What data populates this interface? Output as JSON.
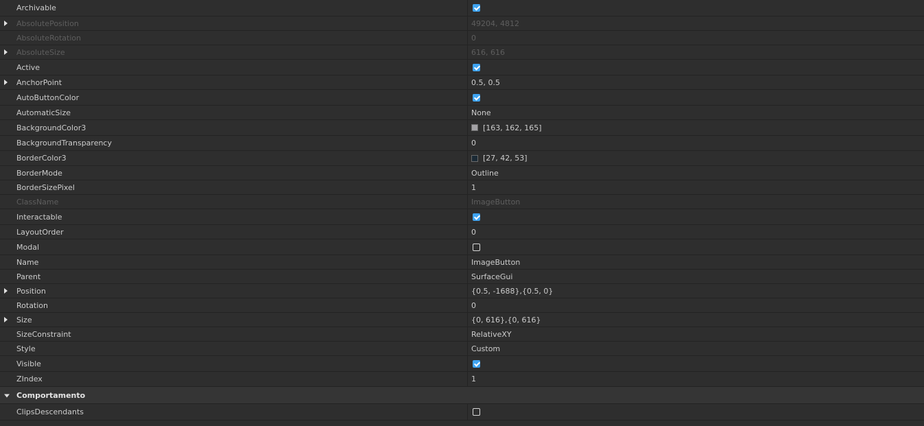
{
  "properties": [
    {
      "name": "Archivable",
      "type": "check",
      "checked": true
    },
    {
      "name": "AbsolutePosition",
      "type": "text",
      "value": "49204, 4812",
      "disabled": true,
      "expandable": true
    },
    {
      "name": "AbsoluteRotation",
      "type": "text",
      "value": "0",
      "disabled": true
    },
    {
      "name": "AbsoluteSize",
      "type": "text",
      "value": "616, 616",
      "disabled": true,
      "expandable": true
    },
    {
      "name": "Active",
      "type": "check",
      "checked": true
    },
    {
      "name": "AnchorPoint",
      "type": "text",
      "value": "0.5, 0.5",
      "expandable": true
    },
    {
      "name": "AutoButtonColor",
      "type": "check",
      "checked": true
    },
    {
      "name": "AutomaticSize",
      "type": "text",
      "value": "None"
    },
    {
      "name": "BackgroundColor3",
      "type": "color",
      "value": "[163, 162, 165]",
      "color": "#a3a2a5"
    },
    {
      "name": "BackgroundTransparency",
      "type": "text",
      "value": "0"
    },
    {
      "name": "BorderColor3",
      "type": "color",
      "value": "[27, 42, 53]",
      "color": "#1b2a35"
    },
    {
      "name": "BorderMode",
      "type": "text",
      "value": "Outline"
    },
    {
      "name": "BorderSizePixel",
      "type": "text",
      "value": "1"
    },
    {
      "name": "ClassName",
      "type": "text",
      "value": "ImageButton",
      "disabled": true
    },
    {
      "name": "Interactable",
      "type": "check",
      "checked": true
    },
    {
      "name": "LayoutOrder",
      "type": "text",
      "value": "0"
    },
    {
      "name": "Modal",
      "type": "check",
      "checked": false
    },
    {
      "name": "Name",
      "type": "text",
      "value": "ImageButton"
    },
    {
      "name": "Parent",
      "type": "text",
      "value": "SurfaceGui"
    },
    {
      "name": "Position",
      "type": "text",
      "value": "{0.5, -1688},{0.5, 0}",
      "expandable": true
    },
    {
      "name": "Rotation",
      "type": "text",
      "value": "0"
    },
    {
      "name": "Size",
      "type": "text",
      "value": "{0, 616},{0, 616}",
      "expandable": true
    },
    {
      "name": "SizeConstraint",
      "type": "text",
      "value": "RelativeXY"
    },
    {
      "name": "Style",
      "type": "text",
      "value": "Custom"
    },
    {
      "name": "Visible",
      "type": "check",
      "checked": true
    },
    {
      "name": "ZIndex",
      "type": "text",
      "value": "1"
    }
  ],
  "section": {
    "title": "Comportamento"
  },
  "section_properties": [
    {
      "name": "ClipsDescendants",
      "type": "check",
      "checked": false
    }
  ],
  "colors": {
    "background": "#2e2e2e",
    "divider": "#232323",
    "text": "#cccccc",
    "disabled_text": "#5e5e5e",
    "checkbox_on": "#3fa4f2"
  }
}
